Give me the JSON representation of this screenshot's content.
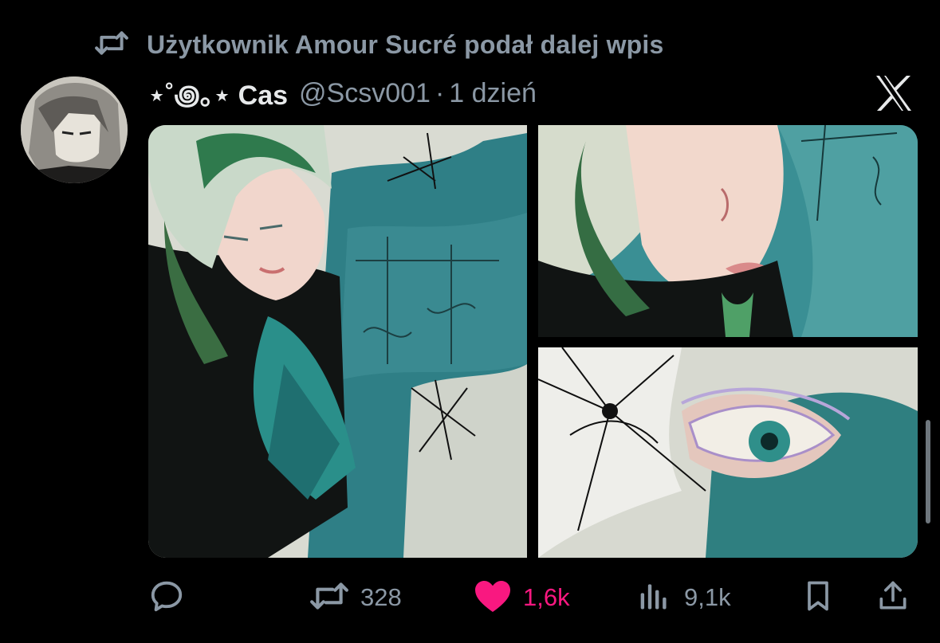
{
  "repost": {
    "icon": "repost-icon",
    "text": "Użytkownik Amour Sucré podał dalej wpis"
  },
  "tweet": {
    "author": {
      "avatar": "avatar-image",
      "display_name": "⋆˚꩜｡⋆ Cas",
      "handle": "@Scsv001",
      "separator": "·",
      "time": "1 dzień"
    },
    "platform_icon": "x-logo-icon",
    "media": [
      {
        "name": "artwork-portrait",
        "description": "painting"
      },
      {
        "name": "artwork-face-closeup",
        "description": "painting"
      },
      {
        "name": "artwork-eye-lily-closeup",
        "description": "painting"
      }
    ],
    "actions": {
      "reply": {
        "icon": "reply-icon",
        "count": ""
      },
      "repost": {
        "icon": "repost-icon",
        "count": "328"
      },
      "like": {
        "icon": "heart-icon",
        "count": "1,6k",
        "active": true,
        "color": "#f91880"
      },
      "views": {
        "icon": "views-icon",
        "count": "9,1k"
      },
      "bookmark": {
        "icon": "bookmark-icon",
        "count": ""
      },
      "share": {
        "icon": "share-icon",
        "count": ""
      }
    }
  },
  "colors": {
    "background": "#000000",
    "secondary_text": "#8b98a5",
    "primary_text": "#e7e9ea",
    "like": "#f91880"
  }
}
